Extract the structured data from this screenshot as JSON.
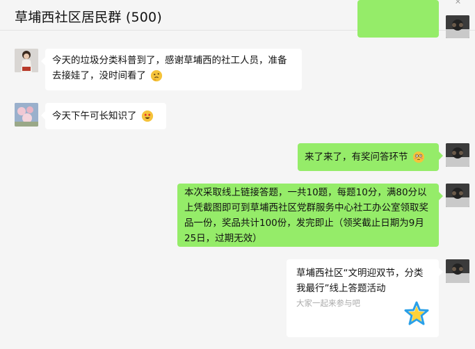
{
  "window": {
    "title": "草埔西社区居民群 (500)"
  },
  "messages": [
    {
      "side": "right",
      "avatar": "avatar-dark",
      "text": ""
    },
    {
      "side": "left",
      "avatar": "avatar-girl",
      "text": "今天的垃圾分类科普到了，感谢草埔西的社工人员，准备去接娃了，没时间看了",
      "emoji": "thinking-face"
    },
    {
      "side": "left",
      "avatar": "avatar-flowers",
      "text": "今天下午可长知识了",
      "emoji": "heart-eyes-face"
    },
    {
      "side": "right",
      "avatar": "avatar-dark",
      "text": "来了来了，有奖问答环节",
      "emoji": "flushed-face"
    },
    {
      "side": "right",
      "avatar": "avatar-dark",
      "text": "本次采取线上链接答题，一共10题，每题10分，满80分以上凭截图即可到草埔西社区党群服务中心社工办公室领取奖品一份，奖品共计100份，发完即止（领奖截止日期为9月25日，过期无效）"
    }
  ],
  "card": {
    "title": "草埔西社区“文明迎双节，分类我最行”线上答题活动",
    "description": "大家一起来参与吧",
    "icon": "star-icon"
  },
  "colors": {
    "bubble_self": "#95ec69",
    "bubble_other": "#ffffff",
    "background": "#f5f5f5"
  }
}
